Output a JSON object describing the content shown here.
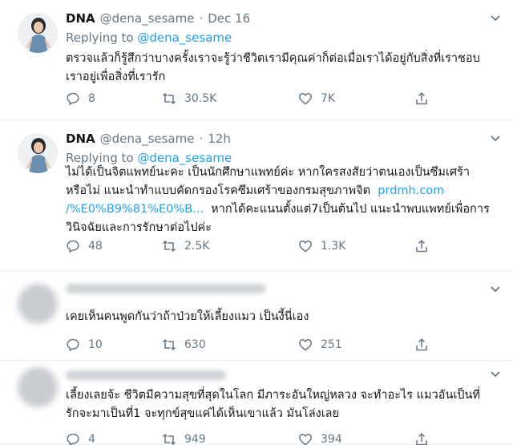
{
  "tweets": [
    {
      "name": "DNA",
      "handle": "@dena_sesame",
      "dot": "·",
      "time": "Dec 16",
      "replying_prefix": "Replying to",
      "replying_handle": "@dena_sesame",
      "text_line1": "ตรวจแล้วก็รู้สึกว่าบางครั้งเราจะรู้ว่าชีวิตเรามีคุณค่าก็ต่อเมื่อเราได้อยู่กับสิ่งที่เราชอบ",
      "text_line2": "เราอยู่เพื่อสิ่งที่เรารัก",
      "replies": "8",
      "retweets": "30.5K",
      "likes": "7K"
    },
    {
      "name": "DNA",
      "handle": "@dena_sesame",
      "dot": "·",
      "time": "12h",
      "replying_prefix": "Replying to",
      "replying_handle": "@dena_sesame",
      "text_line1": "ไม่ได้เป็นจิตแพทย์นะคะ เป็นนักศึกษาแพทย์ค่ะ หากใครสงสัยว่าตนเองเป็นซึมเศร้า",
      "text_line2a": "หรือไม่ แนะนำทำแบบคัดกรองโรคซึมเศร้าของกรมสุขภาพจิต",
      "text_link1": "prdmh.com",
      "text_link2": "/%E0%B9%81%E0%B...",
      "text_line3b": "หากได้คะแนนตั้งแต่7เป็นต้นไป แนะนำพบแพทย์เพื่อการ",
      "text_line4": "วินิจฉัยและการรักษาต่อไปค่ะ",
      "replies": "48",
      "retweets": "2.5K",
      "likes": "1.3K"
    },
    {
      "text_line1": "เคยเห็นคนพูดกันว่าถ้าป่วยให้เลี้ยงแมว เป็นงี้นี่เอง",
      "replies": "10",
      "retweets": "630",
      "likes": "251"
    },
    {
      "text_line1": "เลี้ยงเลยจ้ะ ชีวิตมีความสุขที่สุดในโลก มีภาระอันใหญ่หลวง จะทำอะไร แมวอันเป็นที่",
      "text_line2": "รักจะมาเป็นที่1 จะทุกข์สุขแค่ได้เห็นเขาแล้ว มันโล่งเลย",
      "replies": "4",
      "retweets": "949",
      "likes": "394"
    }
  ],
  "colors": {
    "text": "#14171a",
    "muted": "#657786",
    "link": "#1da1f2",
    "border": "#e6ecf0"
  },
  "icons": [
    "reply-icon",
    "retweet-icon",
    "like-icon",
    "share-icon",
    "chevron-down-icon",
    "avatar"
  ]
}
